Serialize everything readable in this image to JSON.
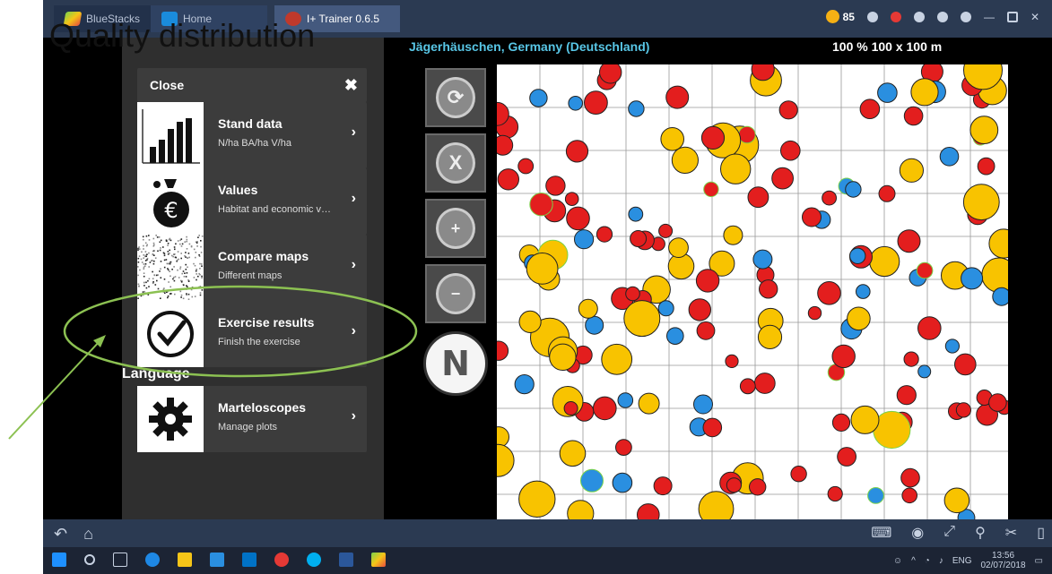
{
  "overlay_title": "Quality distribution",
  "window": {
    "tabs": [
      {
        "label": "BlueStacks"
      },
      {
        "label": "Home"
      },
      {
        "label": "I+ Trainer 0.6.5"
      }
    ],
    "coins": "85"
  },
  "menu": {
    "close_label": "Close",
    "close_icon": "✖",
    "language_label": "Language",
    "items": [
      {
        "title": "Stand data",
        "subtitle": "N/ha BA/ha V/ha",
        "icon": "bar-chart-icon"
      },
      {
        "title": "Values",
        "subtitle": "Habitat and economic val...",
        "icon": "money-bag-icon"
      },
      {
        "title": "Compare maps",
        "subtitle": "Different maps",
        "icon": "map-texture-icon"
      },
      {
        "title": "Exercise results",
        "subtitle": "Finish the exercise",
        "icon": "checkmark-circle-icon"
      },
      {
        "title": "Marteloscopes",
        "subtitle": "Manage plots",
        "icon": "gear-icon"
      }
    ],
    "chevron": "›"
  },
  "map": {
    "location": "Jägerhäuschen, Germany (Deutschland)",
    "scale": "100 % 100 x 100 m",
    "compass_label": "N"
  },
  "taskbar": {
    "language": "ENG",
    "time": "13:56",
    "date": "02/07/2018"
  },
  "colors": {
    "yellow_tree": "#f8c300",
    "red_tree": "#e31e1e",
    "blue_tree": "#2a8fe0",
    "annotation_green": "#8cc152",
    "location_text": "#58c6e6"
  }
}
